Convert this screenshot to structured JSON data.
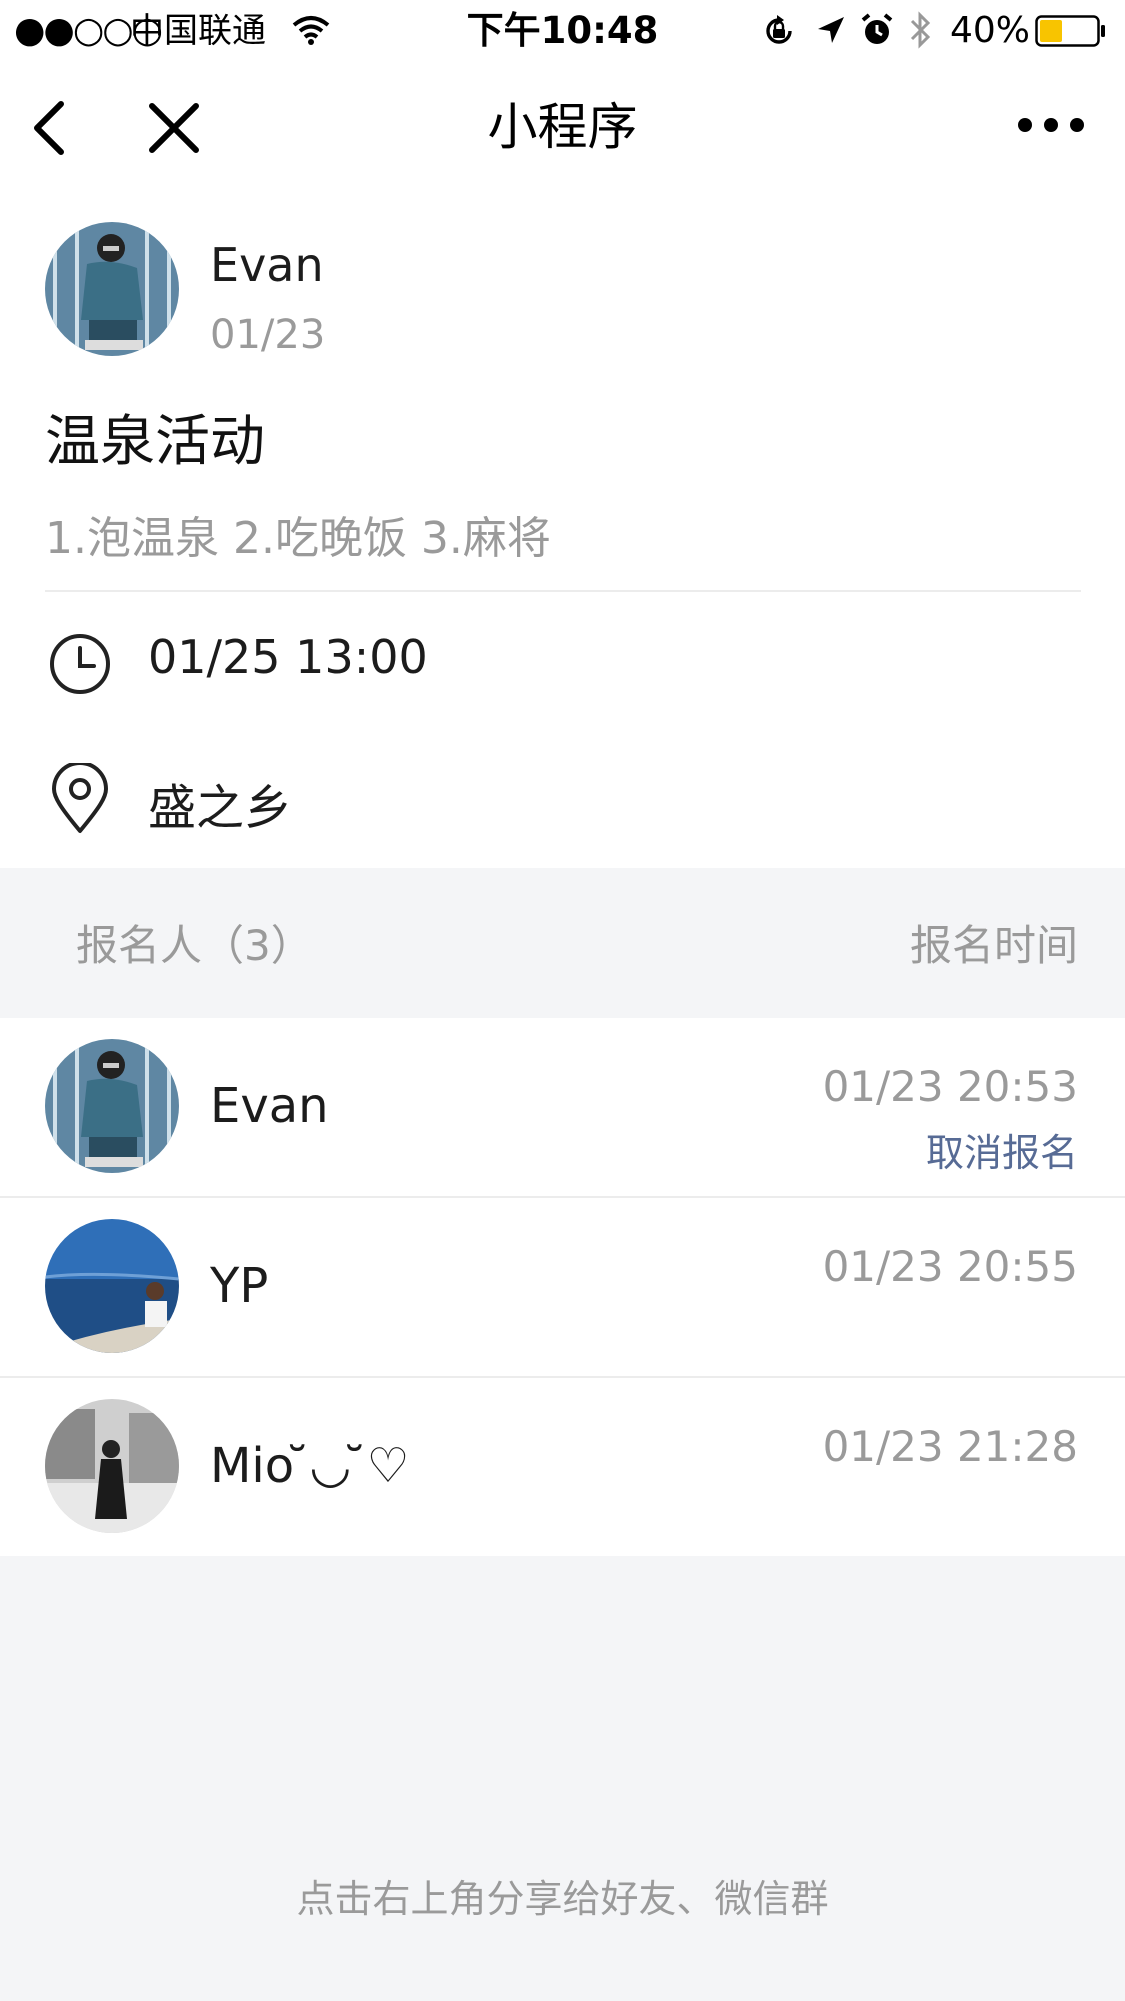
{
  "status_bar": {
    "signal": "●●○○○",
    "carrier": "中国联通",
    "time": "下午10:48",
    "battery": "40%",
    "battery_level": 0.4,
    "icons": [
      "wifi-icon",
      "orientation-lock-icon",
      "location-arrow-icon",
      "alarm-icon",
      "bluetooth-icon",
      "battery-icon"
    ]
  },
  "nav": {
    "title": "小程序",
    "back_icon": "chevron-left-icon",
    "close_icon": "close-icon",
    "more_icon": "more-dots-icon"
  },
  "activity": {
    "organizer": "Evan",
    "date": "01/23",
    "title": "温泉活动",
    "description": "1.泡温泉 2.吃晚饭 3.麻将",
    "start_time": "01/25 13:00",
    "location": "盛之乡"
  },
  "signup": {
    "header_left": "报名人（3）",
    "header_right": "报名时间",
    "entries": [
      {
        "name": "Evan",
        "time": "01/23 20:53",
        "action": "取消报名"
      },
      {
        "name": "YP",
        "time": "01/23 20:55"
      },
      {
        "name": "Mio ̆◡ ̆♡",
        "time": "01/23 21:28"
      }
    ]
  },
  "footer_hint": "点击右上角分享给好友、微信群",
  "colors": {
    "background": "#f4f5f7",
    "link_blue": "#576b95",
    "muted_text": "#9a9a9a",
    "battery_fill": "#f8c400"
  }
}
